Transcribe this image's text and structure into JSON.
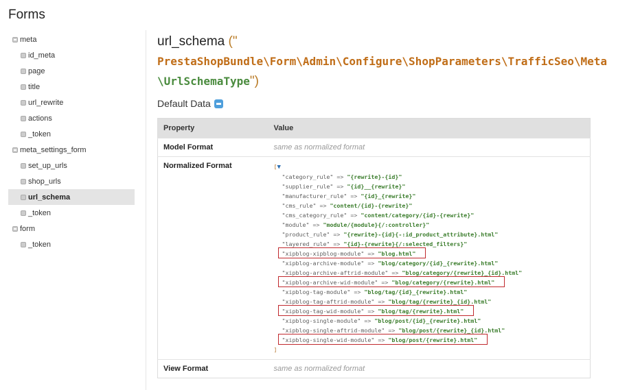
{
  "page": {
    "title": "Forms"
  },
  "sidebar": {
    "items": [
      {
        "label": "meta",
        "level": 0,
        "active": false
      },
      {
        "label": "id_meta",
        "level": 1,
        "active": false
      },
      {
        "label": "page",
        "level": 1,
        "active": false
      },
      {
        "label": "title",
        "level": 1,
        "active": false
      },
      {
        "label": "url_rewrite",
        "level": 1,
        "active": false
      },
      {
        "label": "actions",
        "level": 1,
        "active": false
      },
      {
        "label": "_token",
        "level": 1,
        "active": false
      },
      {
        "label": "meta_settings_form",
        "level": 0,
        "active": false
      },
      {
        "label": "set_up_urls",
        "level": 1,
        "active": false
      },
      {
        "label": "shop_urls",
        "level": 1,
        "active": false
      },
      {
        "label": "url_schema",
        "level": 1,
        "active": true
      },
      {
        "label": "_token",
        "level": 1,
        "active": false
      },
      {
        "label": "form",
        "level": 0,
        "active": false
      },
      {
        "label": "_token",
        "level": 1,
        "active": false
      }
    ]
  },
  "main": {
    "field_name": "url_schema",
    "open_paren": "(\"",
    "close_paren": "\")",
    "class_line1": "PrestaShopBundle\\Form\\Admin\\Configure\\ShopParameters\\TrafficSeo\\Meta",
    "class_line2": "\\UrlSchemaType",
    "default_data_label": "Default Data",
    "table": {
      "headers": {
        "property": "Property",
        "value": "Value"
      },
      "model_format": {
        "label": "Model Format",
        "value": "same as normalized format"
      },
      "normalized_format": {
        "label": "Normalized Format",
        "open": "[",
        "close": "]",
        "entries": [
          {
            "key": "\"category_rule\"",
            "value": "\"{rewrite}-{id}\"",
            "highlighted": false
          },
          {
            "key": "\"supplier_rule\"",
            "value": "\"{id}__{rewrite}\"",
            "highlighted": false
          },
          {
            "key": "\"manufacturer_rule\"",
            "value": "\"{id}_{rewrite}\"",
            "highlighted": false
          },
          {
            "key": "\"cms_rule\"",
            "value": "\"content/{id}-{rewrite}\"",
            "highlighted": false
          },
          {
            "key": "\"cms_category_rule\"",
            "value": "\"content/category/{id}-{rewrite}\"",
            "highlighted": false
          },
          {
            "key": "\"module\"",
            "value": "\"module/{module}{/:controller}\"",
            "highlighted": false
          },
          {
            "key": "\"product_rule\"",
            "value": "\"{rewrite}-{id}{-:id_product_attribute}.html\"",
            "highlighted": false
          },
          {
            "key": "\"layered_rule\"",
            "value": "\"{id}-{rewrite}{/:selected_filters}\"",
            "highlighted": false
          },
          {
            "key": "\"xipblog-xipblog-module\"",
            "value": "\"blog.html\"",
            "highlighted": true
          },
          {
            "key": "\"xipblog-archive-module\"",
            "value": "\"blog/category/{id}_{rewrite}.html\"",
            "highlighted": false
          },
          {
            "key": "\"xipblog-archive-aftrid-module\"",
            "value": "\"blog/category/{rewrite}_{id}.html\"",
            "highlighted": false
          },
          {
            "key": "\"xipblog-archive-wid-module\"",
            "value": "\"blog/category/{rewrite}.html\"",
            "highlighted": true
          },
          {
            "key": "\"xipblog-tag-module\"",
            "value": "\"blog/tag/{id}_{rewrite}.html\"",
            "highlighted": false
          },
          {
            "key": "\"xipblog-tag-aftrid-module\"",
            "value": "\"blog/tag/{rewrite}_{id}.html\"",
            "highlighted": false
          },
          {
            "key": "\"xipblog-tag-wid-module\"",
            "value": "\"blog/tag/{rewrite}.html\"",
            "highlighted": true
          },
          {
            "key": "\"xipblog-single-module\"",
            "value": "\"blog/post/{id}_{rewrite}.html\"",
            "highlighted": false
          },
          {
            "key": "\"xipblog-single-aftrid-module\"",
            "value": "\"blog/post/{rewrite}_{id}.html\"",
            "highlighted": false
          },
          {
            "key": "\"xipblog-single-wid-module\"",
            "value": "\"blog/post/{rewrite}.html\"",
            "highlighted": true
          }
        ]
      },
      "view_format": {
        "label": "View Format",
        "value": "same as normalized format"
      }
    }
  },
  "colors": {
    "highlight_box": "#c0282d",
    "class_name": "#c06d17",
    "class_tail": "#4a8b3e",
    "toggle": "#4f9fdc"
  }
}
